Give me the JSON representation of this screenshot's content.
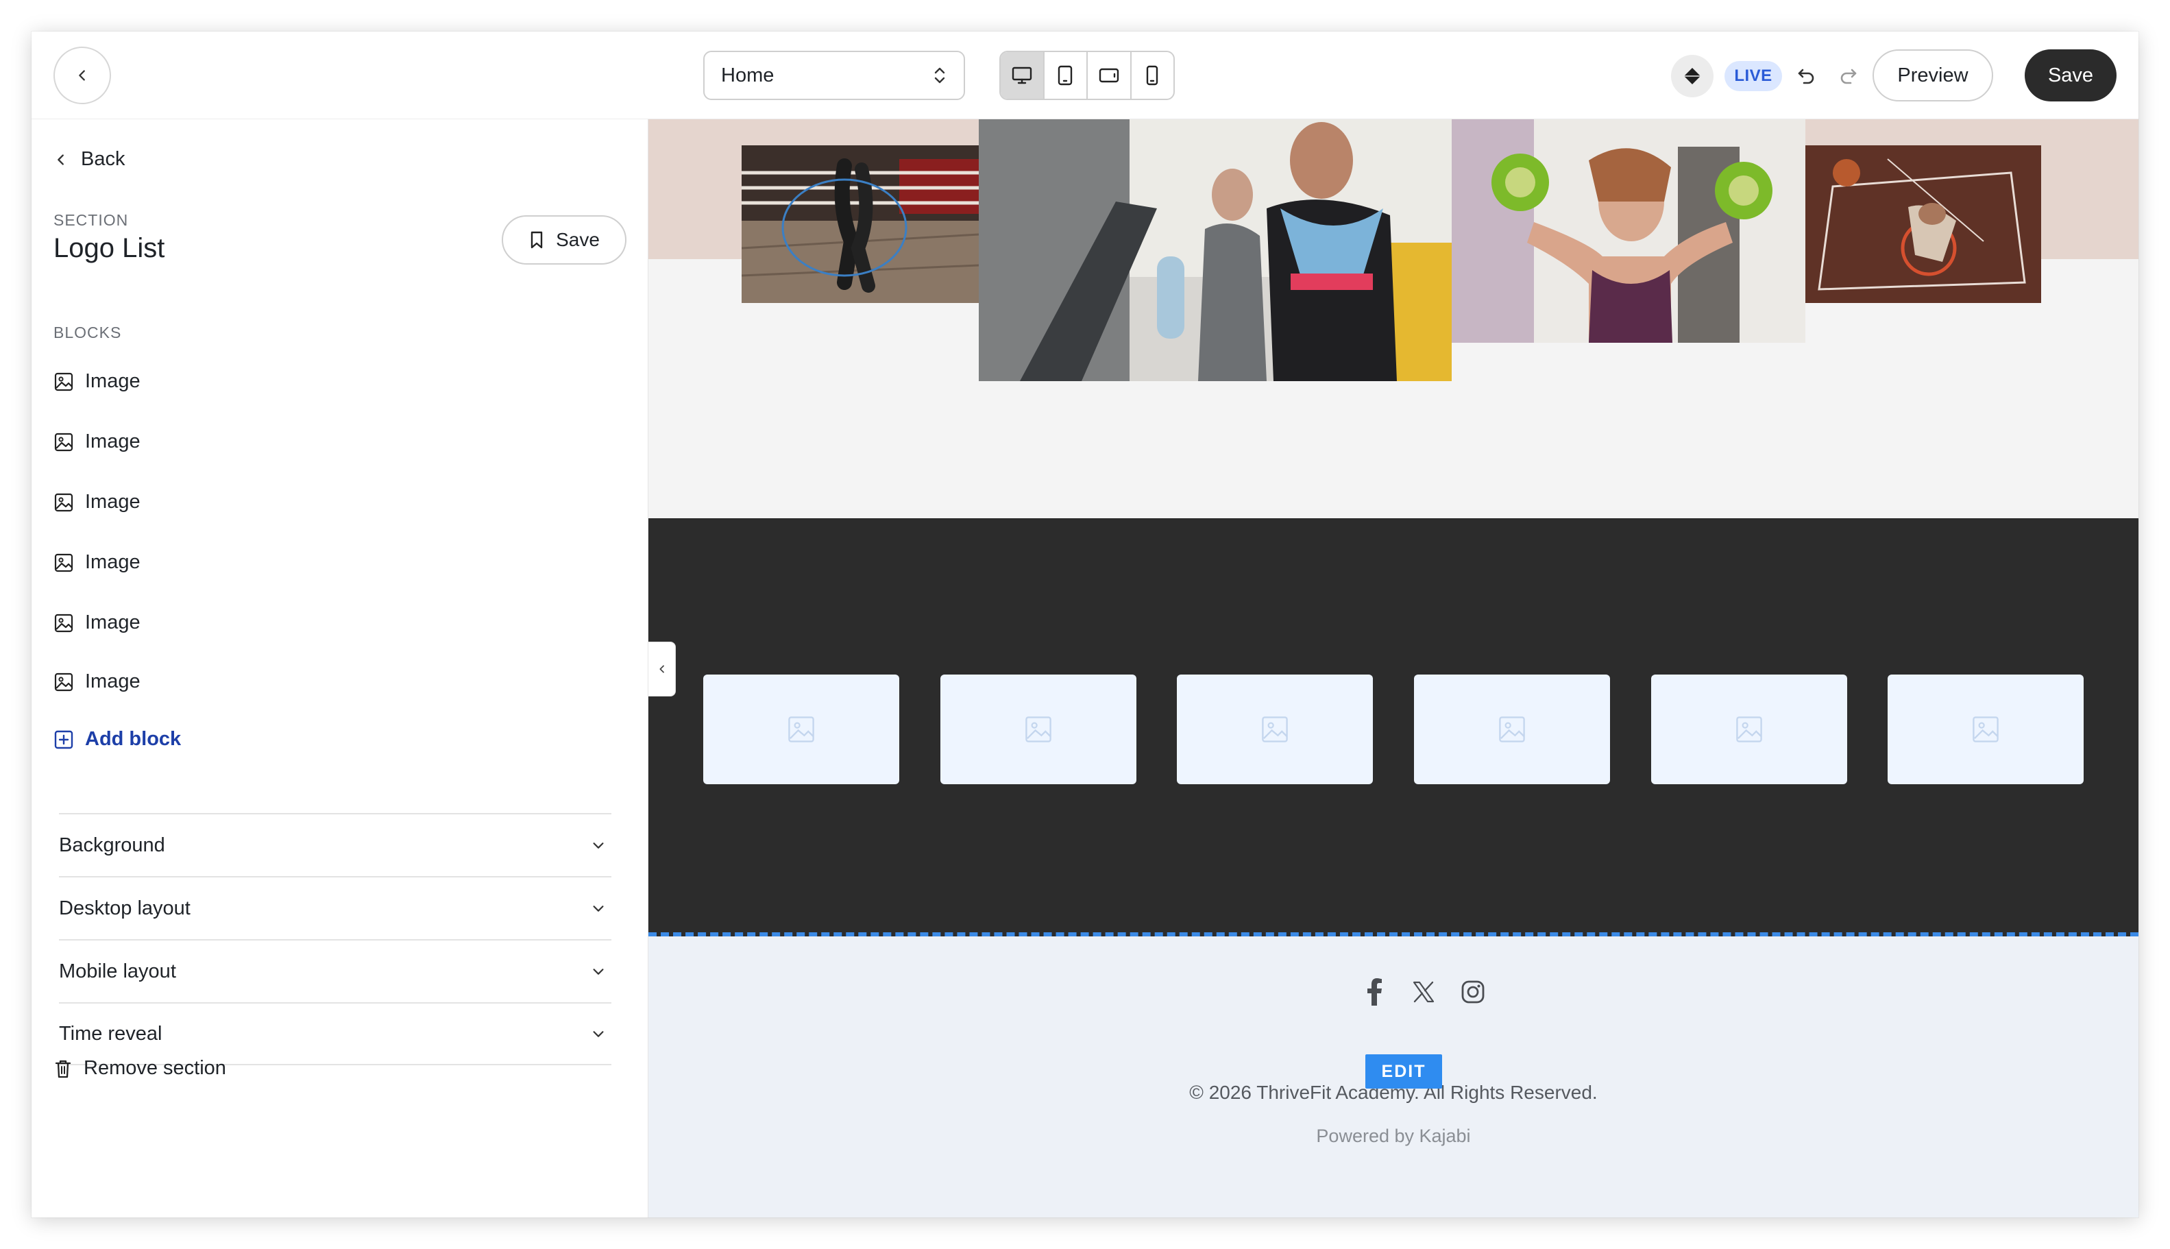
{
  "topbar": {
    "page_select_value": "Home",
    "live_label": "LIVE",
    "preview_label": "Preview",
    "save_label": "Save"
  },
  "sidebar": {
    "back_label": "Back",
    "eyebrow": "SECTION",
    "title": "Logo List",
    "save_label": "Save",
    "blocks_label": "BLOCKS",
    "blocks": [
      {
        "label": "Image"
      },
      {
        "label": "Image"
      },
      {
        "label": "Image"
      },
      {
        "label": "Image"
      },
      {
        "label": "Image"
      },
      {
        "label": "Image"
      }
    ],
    "add_block_label": "Add block",
    "accordions": [
      {
        "label": "Background"
      },
      {
        "label": "Desktop layout"
      },
      {
        "label": "Mobile layout"
      },
      {
        "label": "Time reveal"
      }
    ],
    "remove_label": "Remove section"
  },
  "canvas": {
    "footer": {
      "edit_badge": "EDIT",
      "copyright": "© 2026 ThriveFit Academy. All Rights Reserved.",
      "powered": "Powered by Kajabi"
    }
  },
  "colors": {
    "accent_dark": "#2b2b2b",
    "live_bg": "#dbe7ff",
    "live_text": "#2a5bd7",
    "link_blue": "#1d3fa8",
    "edit_blue": "#2f8cf0",
    "dark_section": "#2c2c2c",
    "footer_bg": "#edf1f7"
  },
  "icons": {
    "back": "chevron-left-icon",
    "page_select": "chevron-up-down-icon",
    "devices": [
      "desktop-icon",
      "tablet-portrait-icon",
      "tablet-landscape-icon",
      "mobile-icon"
    ],
    "diamond": "diamond-icon",
    "undo": "undo-icon",
    "redo": "redo-icon",
    "bookmark": "bookmark-icon",
    "image": "image-icon",
    "add": "plus-square-icon",
    "chevron": "chevron-down-icon",
    "trash": "trash-icon",
    "social": [
      "facebook-icon",
      "x-twitter-icon",
      "instagram-icon"
    ]
  }
}
